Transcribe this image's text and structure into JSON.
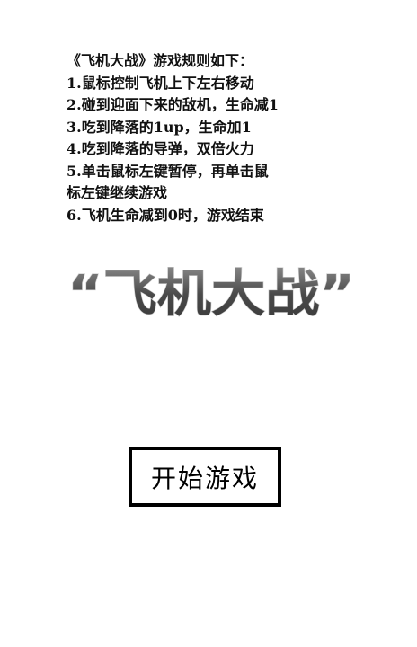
{
  "rules": {
    "title": "《飞机大战》游戏规则如下：",
    "lines": [
      "1.鼠标控制飞机上下左右移动",
      "2.碰到迎面下来的敌机，生命减1",
      "3.吃到降落的1up，生命加1",
      "4.吃到降落的导弹，双倍火力",
      "5.单击鼠标左键暂停，再单击鼠",
      "标左键继续游戏",
      "6.飞机生命减到0时，游戏结束"
    ]
  },
  "logo": {
    "text": "“飞机大战”"
  },
  "start_button": {
    "label": "开始游戏"
  },
  "colors": {
    "background": "#ffffff",
    "text": "#111111",
    "logo_fill": "#555555",
    "logo_highlight": "#cccccc",
    "button_border": "#000000"
  }
}
